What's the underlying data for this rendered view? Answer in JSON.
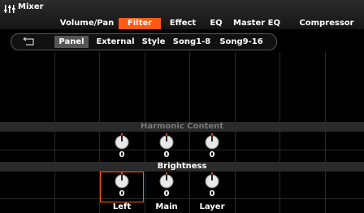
{
  "header": {
    "title": "Mixer",
    "icon": "mixer-sliders-icon",
    "tabs": [
      {
        "label": "Volume/Pan"
      },
      {
        "label": "Filter",
        "active": true
      },
      {
        "label": "Effect"
      },
      {
        "label": "EQ"
      },
      {
        "label": "Master EQ"
      },
      {
        "label": "Compressor"
      }
    ]
  },
  "subtabs": {
    "icon": "back-arrow-icon",
    "items": [
      {
        "label": "Panel",
        "active": true
      },
      {
        "label": "External"
      },
      {
        "label": "Style"
      },
      {
        "label": "Song1-8"
      },
      {
        "label": "Song9-16"
      }
    ]
  },
  "sections": {
    "harmonic": {
      "label": "Harmonic Content",
      "values": [
        "0",
        "0",
        "0"
      ]
    },
    "brightness": {
      "label": "Brightness",
      "values": [
        "0",
        "0",
        "0"
      ]
    }
  },
  "columns": [
    "Left",
    "Main",
    "Layer"
  ],
  "colors": {
    "accent": "#ff5a14",
    "knob_marker": "#ff3b1f"
  }
}
